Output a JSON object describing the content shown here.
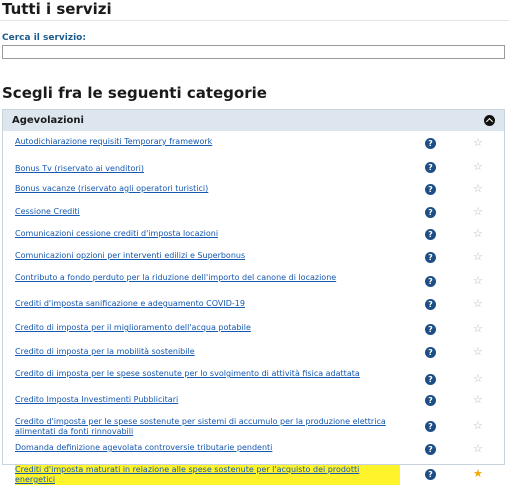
{
  "page": {
    "title": "Tutti i servizi",
    "search_label": "Cerca il servizio:",
    "search_value": "",
    "categories_title": "Scegli fra le seguenti categorie"
  },
  "panel": {
    "title": "Agevolazioni",
    "expanded": true,
    "items": [
      {
        "label": "Autodichiarazione requisiti Temporary framework",
        "favorite": false,
        "highlighted": false
      },
      {
        "label": "Bonus Tv (riservato ai venditori)",
        "favorite": false,
        "highlighted": false
      },
      {
        "label": "Bonus vacanze (riservato agli operatori turistici)",
        "favorite": false,
        "highlighted": false
      },
      {
        "label": "Cessione Crediti",
        "favorite": false,
        "highlighted": false
      },
      {
        "label": "Comunicazioni cessione crediti d'imposta locazioni",
        "favorite": false,
        "highlighted": false
      },
      {
        "label": "Comunicazioni opzioni per interventi edilizi e Superbonus",
        "favorite": false,
        "highlighted": false
      },
      {
        "label": "Contributo a fondo perduto per la riduzione dell'importo del canone di locazione",
        "favorite": false,
        "highlighted": false
      },
      {
        "label": "Crediti d'imposta sanificazione e adeguamento COVID-19",
        "favorite": false,
        "highlighted": false
      },
      {
        "label": "Credito di imposta per il miglioramento dell'acqua potabile",
        "favorite": false,
        "highlighted": false
      },
      {
        "label": "Credito di imposta per la mobilità sostenibile",
        "favorite": false,
        "highlighted": false
      },
      {
        "label": "Credito di imposta per le spese sostenute per lo svolgimento di attività fisica adattata",
        "favorite": false,
        "highlighted": false
      },
      {
        "label": "Credito Imposta Investimenti Pubblicitari",
        "favorite": false,
        "highlighted": false
      },
      {
        "label": "Credito d'imposta per le spese sostenute per sistemi di accumulo per la produzione elettrica alimentati da fonti rinnovabili",
        "favorite": false,
        "highlighted": false
      },
      {
        "label": "Domanda definizione agevolata controversie tributarie pendenti",
        "favorite": false,
        "highlighted": false
      },
      {
        "label": "Crediti d'imposta maturati in relazione alle spese sostenute per l'acquisto dei prodotti energetici",
        "favorite": true,
        "highlighted": true
      }
    ]
  },
  "icons": {
    "help": "question-circle-icon",
    "favorite": "star-icon",
    "collapse": "chevron-up-icon"
  },
  "colors": {
    "link": "#1558b0",
    "panel_header": "#dde6ee",
    "help_icon": "#1d4f86",
    "favorite_star": "#f2a900",
    "highlight": "#fff32b"
  }
}
